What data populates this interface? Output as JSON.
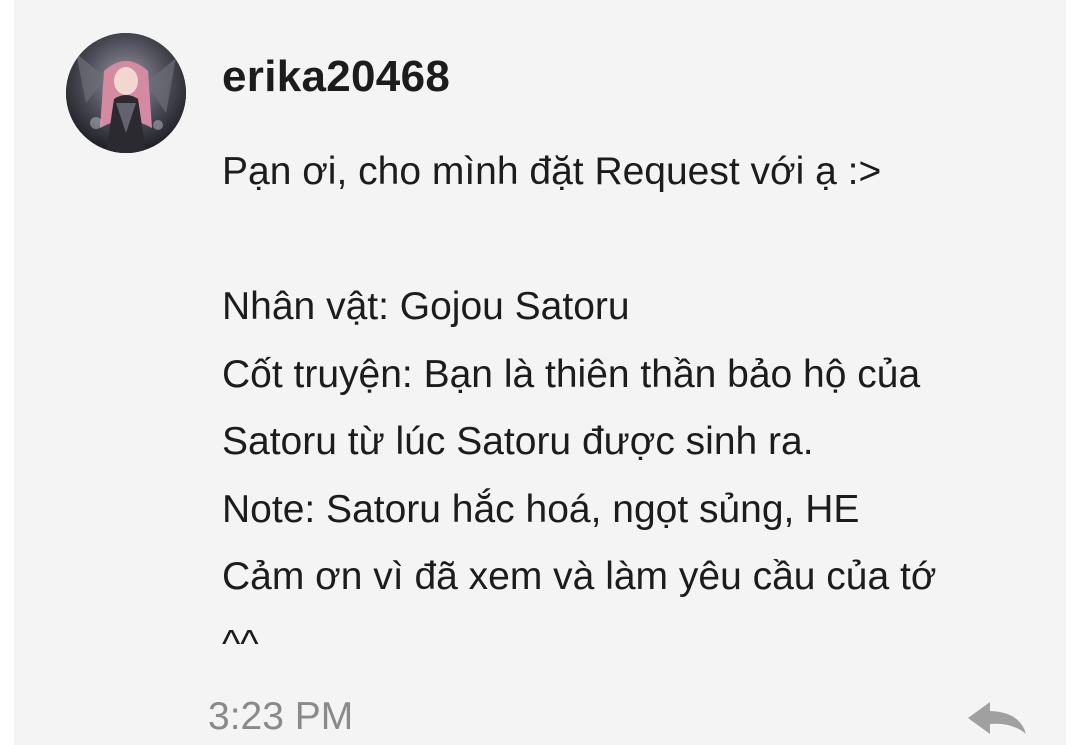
{
  "comment": {
    "author": "erika20468",
    "avatar_icon": "anime-character-avatar",
    "lines": [
      "Pạn ơi, cho mình đặt Request với ạ :>",
      "",
      "Nhân vật: Gojou Satoru",
      "Cốt truyện: Bạn là thiên thần bảo hộ của",
      "Satoru từ lúc Satoru được sinh ra.",
      "Note: Satoru hắc hoá, ngọt sủng, HE",
      "Cảm ơn vì đã xem và làm yêu cầu của tớ",
      "^^"
    ],
    "time": "3:23 PM",
    "reply_icon": "reply-arrow-icon"
  },
  "colors": {
    "card_background": "#f4f4f4",
    "text": "#1c1c1c",
    "timestamp": "#8a8a8a",
    "icon": "#a0a0a0"
  }
}
